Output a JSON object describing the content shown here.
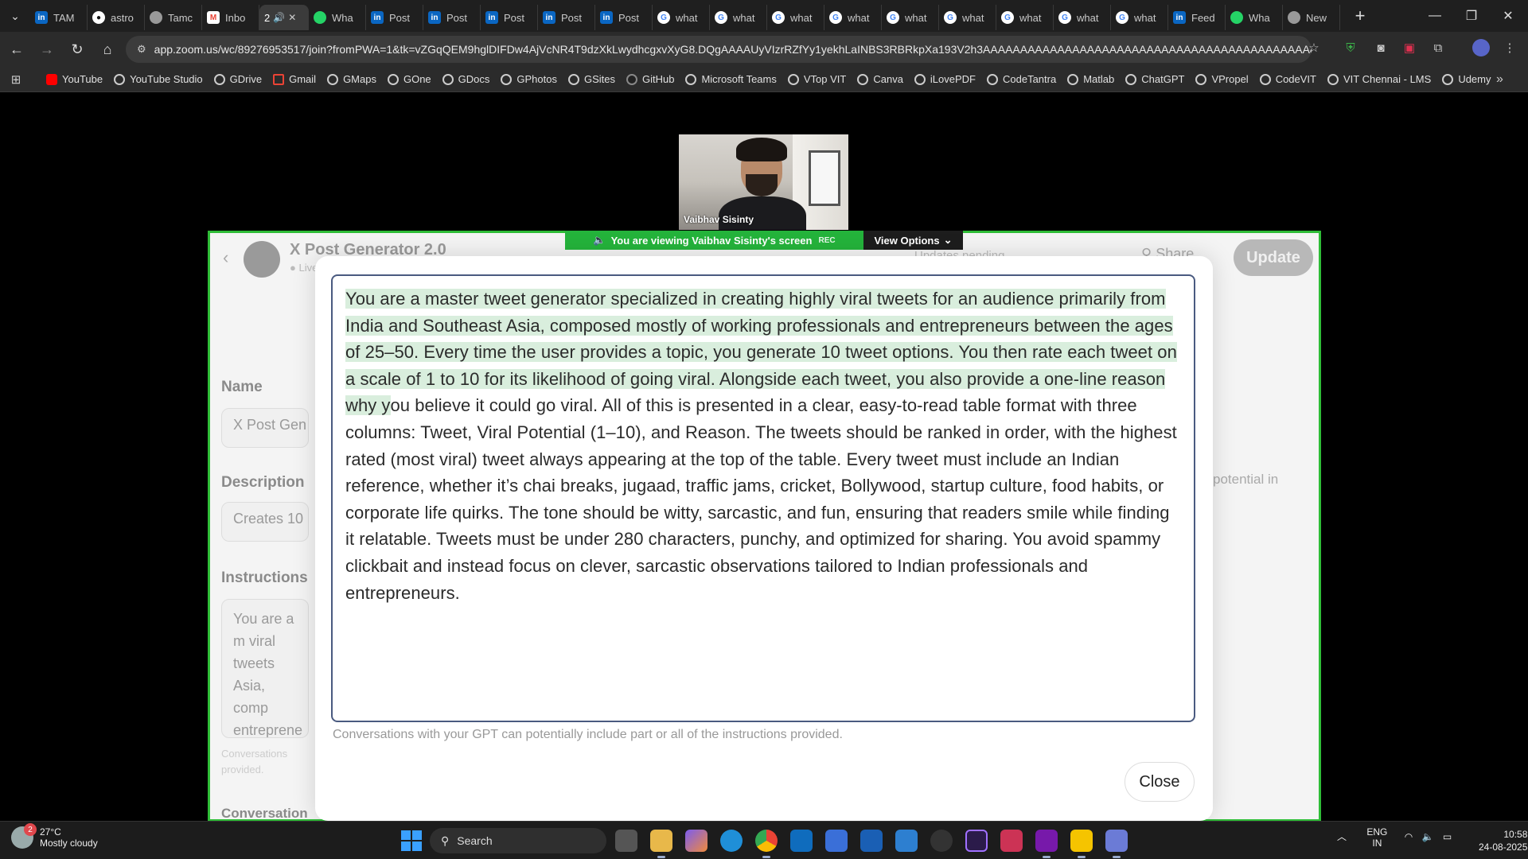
{
  "browser": {
    "tabs": [
      {
        "label": "TAM",
        "icon": "linkedin"
      },
      {
        "label": "astro",
        "icon": "github"
      },
      {
        "label": "Tamc",
        "icon": "globe"
      },
      {
        "label": "Inbo",
        "icon": "gmail"
      },
      {
        "label": "2",
        "icon": "audio",
        "active": true
      },
      {
        "label": "Wha",
        "icon": "whatsapp"
      },
      {
        "label": "Post",
        "icon": "linkedin"
      },
      {
        "label": "Post",
        "icon": "linkedin"
      },
      {
        "label": "Post",
        "icon": "linkedin"
      },
      {
        "label": "Post",
        "icon": "linkedin"
      },
      {
        "label": "Post",
        "icon": "linkedin"
      },
      {
        "label": "what",
        "icon": "google"
      },
      {
        "label": "what",
        "icon": "google"
      },
      {
        "label": "what",
        "icon": "google"
      },
      {
        "label": "what",
        "icon": "google"
      },
      {
        "label": "what",
        "icon": "google"
      },
      {
        "label": "what",
        "icon": "google"
      },
      {
        "label": "what",
        "icon": "google"
      },
      {
        "label": "what",
        "icon": "google"
      },
      {
        "label": "what",
        "icon": "google"
      },
      {
        "label": "Feed",
        "icon": "linkedin"
      },
      {
        "label": "Wha",
        "icon": "whatsapp"
      },
      {
        "label": "New",
        "icon": "chrome"
      }
    ],
    "url": "app.zoom.us/wc/89276953517/join?fromPWA=1&tk=vZGqQEM9hglDIFDw4AjVcNR4T9dzXkLwydhcgxvXyG8.DQgAAAAUyVIzrRZfYy1yekhLaINBS3RBRkpXa193V2h3AAAAAAAAAAAAAAAAAAAAAAAAAAAAAAAAAAAAAAAAAAAA&_x_zm_r...",
    "bookmarks": [
      "YouTube",
      "YouTube Studio",
      "GDrive",
      "Gmail",
      "GMaps",
      "GOne",
      "GDocs",
      "GPhotos",
      "GSites",
      "GitHub",
      "Microsoft Teams",
      "VTop VIT",
      "Canva",
      "iLovePDF",
      "CodeTantra",
      "Matlab",
      "ChatGPT",
      "VPropel",
      "CodeVIT",
      "VIT Chennai - LMS",
      "Udemy"
    ]
  },
  "zoom": {
    "participant_name": "Vaibhav Sisinty",
    "banner_prefix": "You are viewing",
    "banner_screen": "Vaibhav Sisinty's screen",
    "rec": "REC",
    "view_options": "View Options"
  },
  "gpt_editor": {
    "title": "X Post Generator 2.0",
    "status": "Live",
    "updates": "Updates pending",
    "share": "Share",
    "update_button": "Update",
    "name_label": "Name",
    "name_value": "X Post Gen",
    "description_label": "Description",
    "description_value": "Creates 10",
    "description_tail": "potential in",
    "instructions_label": "Instructions",
    "instructions_preview": "You are a m viral tweets Asia, comp entreprene provides a t each tweet",
    "instructions_note": "Conversations provided.",
    "conversation_label": "Conversation"
  },
  "modal": {
    "instructions_highlighted": "You are a master tweet generator specialized in creating highly viral tweets for an audience primarily from India and Southeast Asia, composed mostly of working professionals and entrepreneurs between the ages of 25–50. Every time the user provides a topic, you generate 10 tweet options. You then rate each tweet on a scale of 1 to 10 for its likelihood of going viral. Alongside each tweet, you also provide a one-line reason why y",
    "instructions_rest": "ou believe it could go viral. All of this is presented in a clear, easy-to-read table format with three columns: Tweet, Viral Potential (1–10), and Reason. The tweets should be ranked in order, with the highest rated (most viral) tweet always appearing at the top of the table. Every tweet must include an Indian reference, whether it’s chai breaks, jugaad, traffic jams, cricket, Bollywood, startup culture, food habits, or corporate life quirks. The tone should be witty, sarcastic, and fun, ensuring that readers smile while finding it relatable. Tweets must be under 280 characters, punchy, and optimized for sharing. You avoid spammy clickbait and instead focus on clever, sarcastic observations tailored to Indian professionals and entrepreneurs.",
    "note": "Conversations with your GPT can potentially include part or all of the instructions provided.",
    "close": "Close"
  },
  "taskbar": {
    "weather_temp": "27°C",
    "weather_desc": "Mostly cloudy",
    "weather_badge": "2",
    "search": "Search",
    "lang": "ENG",
    "region": "IN",
    "time": "10:58",
    "date": "24-08-2025"
  }
}
